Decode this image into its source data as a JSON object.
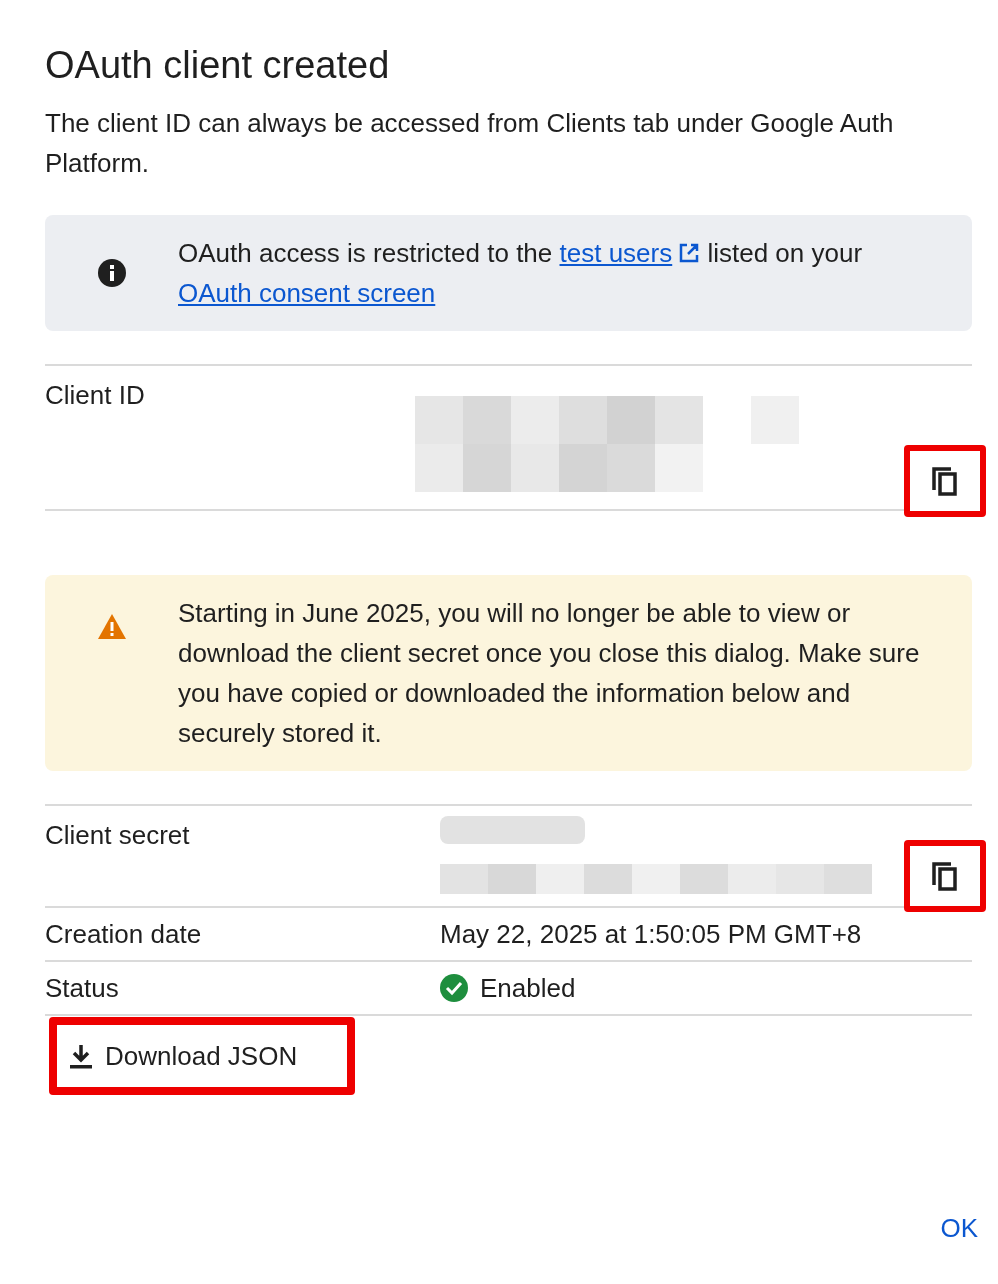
{
  "title": "OAuth client created",
  "description": "The client ID can always be accessed from Clients tab under Google Auth Platform.",
  "info_banner": {
    "kind": "info",
    "before": "OAuth access is restricted to the ",
    "link": "test users",
    "middle": " listed on your ",
    "link2": "OAuth consent screen"
  },
  "client_id": {
    "label": "Client ID",
    "copy_highlighted": true
  },
  "warning_banner": {
    "kind": "warning",
    "text": "Starting in June 2025, you will no longer be able to view or download the client secret once you close this dialog. Make sure you have copied or downloaded the information below and securely stored it."
  },
  "client_secret": {
    "label": "Client secret",
    "copy_highlighted": true
  },
  "details": [
    {
      "label": "Creation date",
      "value": "May 22, 2025 at 1:50:05 PM GMT+8",
      "kind": "text"
    },
    {
      "label": "Status",
      "value": "Enabled",
      "kind": "status"
    }
  ],
  "download_button": {
    "label": "Download JSON",
    "highlighted": true
  },
  "ok_button": "OK"
}
